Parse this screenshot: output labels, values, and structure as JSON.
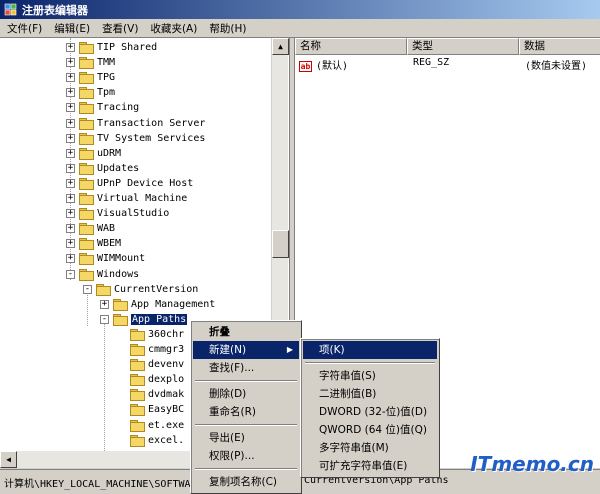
{
  "window": {
    "title": "注册表编辑器"
  },
  "menubar": [
    "文件(F)",
    "编辑(E)",
    "查看(V)",
    "收藏夹(A)",
    "帮助(H)"
  ],
  "tree": [
    {
      "label": "TIP Shared",
      "expand": "+"
    },
    {
      "label": "TMM",
      "expand": "+"
    },
    {
      "label": "TPG",
      "expand": "+"
    },
    {
      "label": "Tpm",
      "expand": "+"
    },
    {
      "label": "Tracing",
      "expand": "+"
    },
    {
      "label": "Transaction Server",
      "expand": "+"
    },
    {
      "label": "TV System Services",
      "expand": "+"
    },
    {
      "label": "uDRM",
      "expand": "+"
    },
    {
      "label": "Updates",
      "expand": "+"
    },
    {
      "label": "UPnP Device Host",
      "expand": "+"
    },
    {
      "label": "Virtual Machine",
      "expand": "+"
    },
    {
      "label": "VisualStudio",
      "expand": "+"
    },
    {
      "label": "WAB",
      "expand": "+"
    },
    {
      "label": "WBEM",
      "expand": "+"
    },
    {
      "label": "WIMMount",
      "expand": "+"
    },
    {
      "label": "Windows",
      "expand": "-"
    },
    {
      "label": "CurrentVersion",
      "expand": "-"
    },
    {
      "label": "App Management",
      "expand": "+"
    },
    {
      "label": "App Paths",
      "expand": "-",
      "selected": true
    },
    {
      "label": "360chr",
      "expand": ""
    },
    {
      "label": "cmmgr3",
      "expand": ""
    },
    {
      "label": "devenv",
      "expand": ""
    },
    {
      "label": "dexplo",
      "expand": ""
    },
    {
      "label": "dvdmak",
      "expand": ""
    },
    {
      "label": "EasyBC",
      "expand": ""
    },
    {
      "label": "et.exe",
      "expand": ""
    },
    {
      "label": "excel.",
      "expand": ""
    }
  ],
  "values_pane": {
    "columns": [
      "名称",
      "类型",
      "数据"
    ],
    "rows": [
      {
        "name": "(默认)",
        "type": "REG_SZ",
        "data": "(数值未设置)"
      }
    ]
  },
  "context_menu": {
    "items": [
      {
        "label": "折叠",
        "bold": true
      },
      {
        "label": "新建(N)",
        "highlighted": true,
        "submenu": true
      },
      {
        "label": "查找(F)..."
      },
      {
        "sep": true
      },
      {
        "label": "删除(D)"
      },
      {
        "label": "重命名(R)"
      },
      {
        "sep": true
      },
      {
        "label": "导出(E)"
      },
      {
        "label": "权限(P)..."
      },
      {
        "sep": true
      },
      {
        "label": "复制项名称(C)"
      }
    ]
  },
  "submenu": {
    "items": [
      {
        "label": "项(K)",
        "highlighted": true
      },
      {
        "sep": true
      },
      {
        "label": "字符串值(S)"
      },
      {
        "label": "二进制值(B)"
      },
      {
        "label": "DWORD (32-位)值(D)"
      },
      {
        "label": "QWORD (64 位)值(Q)"
      },
      {
        "label": "多字符串值(M)"
      },
      {
        "label": "可扩充字符串值(E)"
      }
    ]
  },
  "status_bar": {
    "left": "计算机\\HKEY_LOCAL_MACHINE\\SOFTWA",
    "right": "CurrentVersion\\App Paths"
  },
  "watermark": "ITmemo.cn"
}
